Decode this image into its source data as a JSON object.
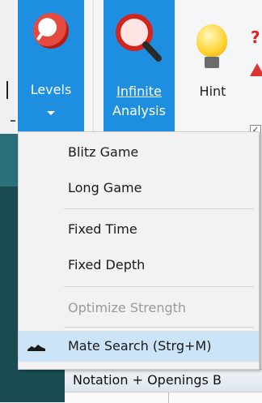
{
  "ribbon": {
    "levels_label": "Levels",
    "analysis_label_line1": "Infinite",
    "analysis_label_line2": "Analysis",
    "hint_label": "Hint"
  },
  "menu": {
    "items": [
      {
        "label": "Blitz Game",
        "enabled": true
      },
      {
        "label": "Long Game",
        "enabled": true
      },
      {
        "label": "Fixed Time",
        "enabled": true
      },
      {
        "label": "Fixed Depth",
        "enabled": true
      },
      {
        "label": "Optimize Strength",
        "enabled": false
      },
      {
        "label": "Mate Search (Strg+M)",
        "enabled": true,
        "selected": true
      }
    ]
  },
  "status": {
    "notation_tab": "Notation + Openings B"
  },
  "colors": {
    "ribbon_accent": "#1e8fe0",
    "menu_highlight": "#cce4f7",
    "disabled_text": "#9a9a9a"
  }
}
